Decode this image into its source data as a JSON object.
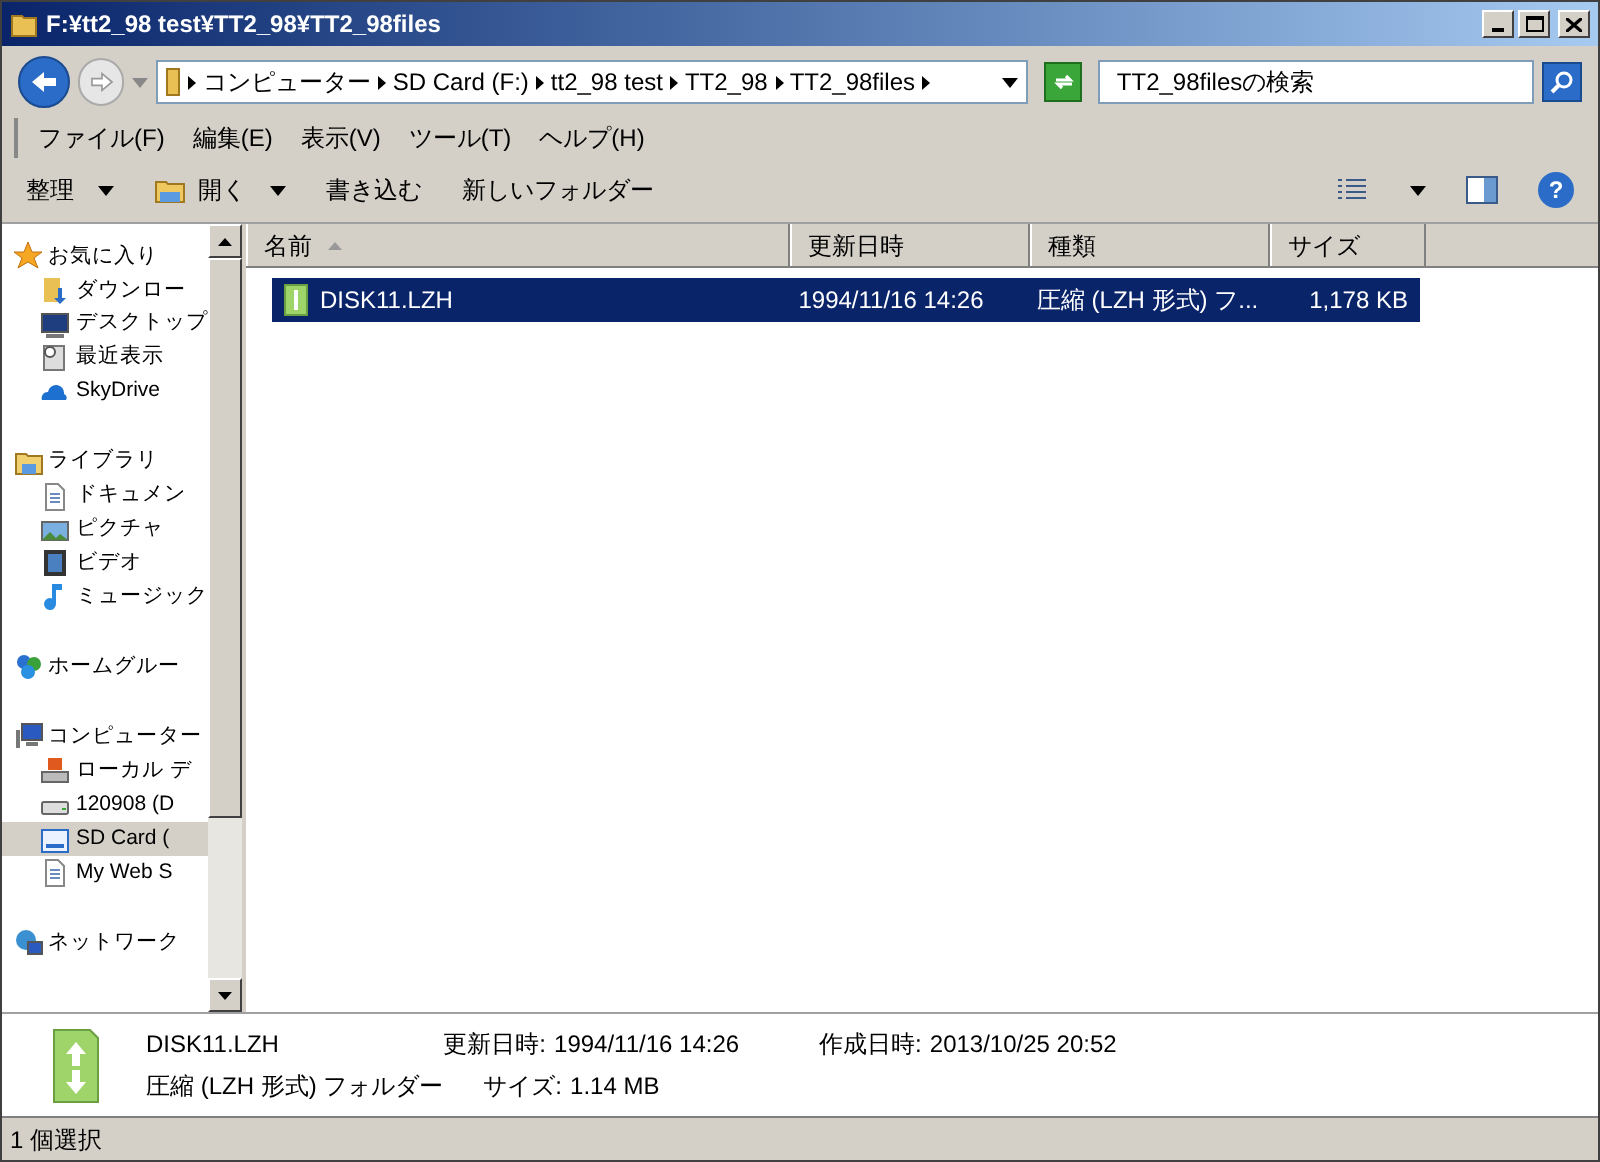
{
  "window": {
    "title": "F:¥tt2_98 test¥TT2_98¥TT2_98files"
  },
  "address": {
    "crumbs": [
      "コンピューター",
      "SD Card (F:)",
      "tt2_98 test",
      "TT2_98",
      "TT2_98files"
    ]
  },
  "search": {
    "placeholder": "TT2_98filesの検索"
  },
  "menu": [
    "ファイル(F)",
    "編集(E)",
    "表示(V)",
    "ツール(T)",
    "ヘルプ(H)"
  ],
  "toolbar": [
    {
      "label": "整理",
      "kind": "dropdown"
    },
    {
      "label": "開く",
      "kind": "open"
    },
    {
      "label": "書き込む",
      "kind": "plain"
    },
    {
      "label": "新しいフォルダー",
      "kind": "plain"
    }
  ],
  "nav": [
    {
      "label": "お気に入り",
      "kind": "star",
      "children": [
        {
          "label": "ダウンロー",
          "kind": "download",
          "selected": false
        },
        {
          "label": "デスクトップ",
          "kind": "desktop",
          "selected": false
        },
        {
          "label": "最近表示",
          "kind": "recent",
          "selected": false
        },
        {
          "label": "SkyDrive",
          "kind": "cloud",
          "selected": false
        }
      ]
    },
    {
      "label": "ライブラリ",
      "kind": "library",
      "children": [
        {
          "label": "ドキュメン",
          "kind": "doc",
          "selected": false
        },
        {
          "label": "ピクチャ",
          "kind": "picture",
          "selected": false
        },
        {
          "label": "ビデオ",
          "kind": "video",
          "selected": false
        },
        {
          "label": "ミュージック",
          "kind": "music",
          "selected": false
        }
      ]
    },
    {
      "label": "ホームグルー",
      "kind": "homegroup"
    },
    {
      "label": "コンピューター",
      "kind": "computer",
      "children": [
        {
          "label": "ローカル デ",
          "kind": "disk",
          "selected": false
        },
        {
          "label": "120908 (D",
          "kind": "drive",
          "selected": false
        },
        {
          "label": "SD Card (",
          "kind": "sd",
          "selected": true
        },
        {
          "label": "My Web S",
          "kind": "doc",
          "selected": false
        }
      ]
    },
    {
      "label": "ネットワーク",
      "kind": "network"
    }
  ],
  "help_icon": "?",
  "table": {
    "columns": [
      {
        "label": "名前",
        "sorted": true
      },
      {
        "label": "更新日時",
        "sorted": false
      },
      {
        "label": "種類",
        "sorted": false
      },
      {
        "label": "サイズ",
        "sorted": false
      }
    ],
    "rows": [
      {
        "cells": [
          "DISK11.LZH",
          "1994/11/16 14:26",
          "圧縮 (LZH 形式) フ...",
          "1,178 KB"
        ],
        "selected": true
      }
    ]
  },
  "details": {
    "name": "DISK11.LZH",
    "type": "圧縮 (LZH 形式) フォルダー",
    "modified_label": "更新日時:",
    "modified": "1994/11/16 14:26",
    "size_label": "サイズ:",
    "size": "1.14 MB",
    "created_label": "作成日時:",
    "created": "2013/10/25 20:52"
  },
  "status_bar": "1 個選択"
}
